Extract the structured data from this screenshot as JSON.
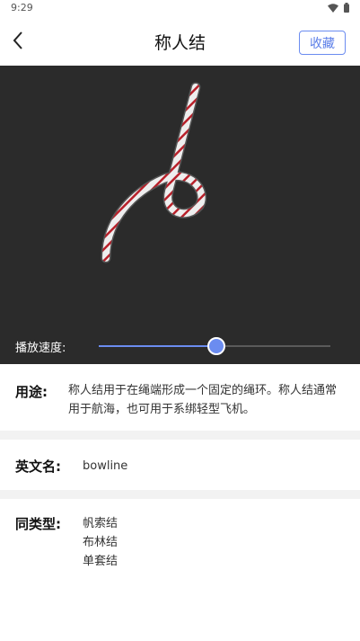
{
  "status_bar": {
    "time": "9:29"
  },
  "app_bar": {
    "title": "称人结",
    "favorite_label": "收藏"
  },
  "player": {
    "speed_label": "播放速度:",
    "speed_value": 0.5
  },
  "usage": {
    "label": "用途:",
    "text": "称人结用于在绳端形成一个固定的绳环。称人结通常用于航海，也可用于系绑轻型飞机。"
  },
  "english_name": {
    "label": "英文名:",
    "value": "bowline"
  },
  "similar": {
    "label": "同类型:",
    "items": [
      "帆索结",
      "布林结",
      "单套结"
    ]
  },
  "colors": {
    "accent": "#6b8cf0",
    "player_bg": "#2b2b2b",
    "rope_red": "#b8202a"
  }
}
